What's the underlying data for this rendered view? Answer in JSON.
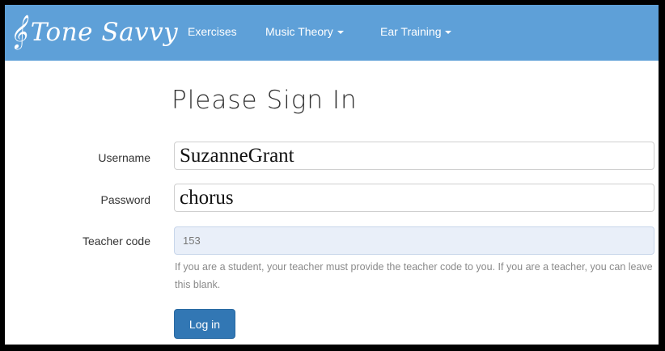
{
  "navbar": {
    "brand_clef": "𝄞",
    "brand": "Tone Savvy",
    "items": [
      {
        "label": "Exercises",
        "has_dropdown": false
      },
      {
        "label": "Music Theory",
        "has_dropdown": true
      },
      {
        "label": "Ear Training",
        "has_dropdown": true
      }
    ]
  },
  "form": {
    "title": "Please Sign In",
    "username_label": "Username",
    "username_value": "SuzanneGrant",
    "password_label": "Password",
    "password_value": "chorus",
    "teacher_code_label": "Teacher code",
    "teacher_code_value": "153",
    "help_text": "If you are a student, your teacher must provide the teacher code to you. If you are a teacher, you can leave this blank.",
    "submit_label": "Log in"
  },
  "colors": {
    "navbar_bg": "#5ea0d8",
    "button_bg": "#3277b4",
    "teacher_code_bg": "#e9eff9"
  }
}
